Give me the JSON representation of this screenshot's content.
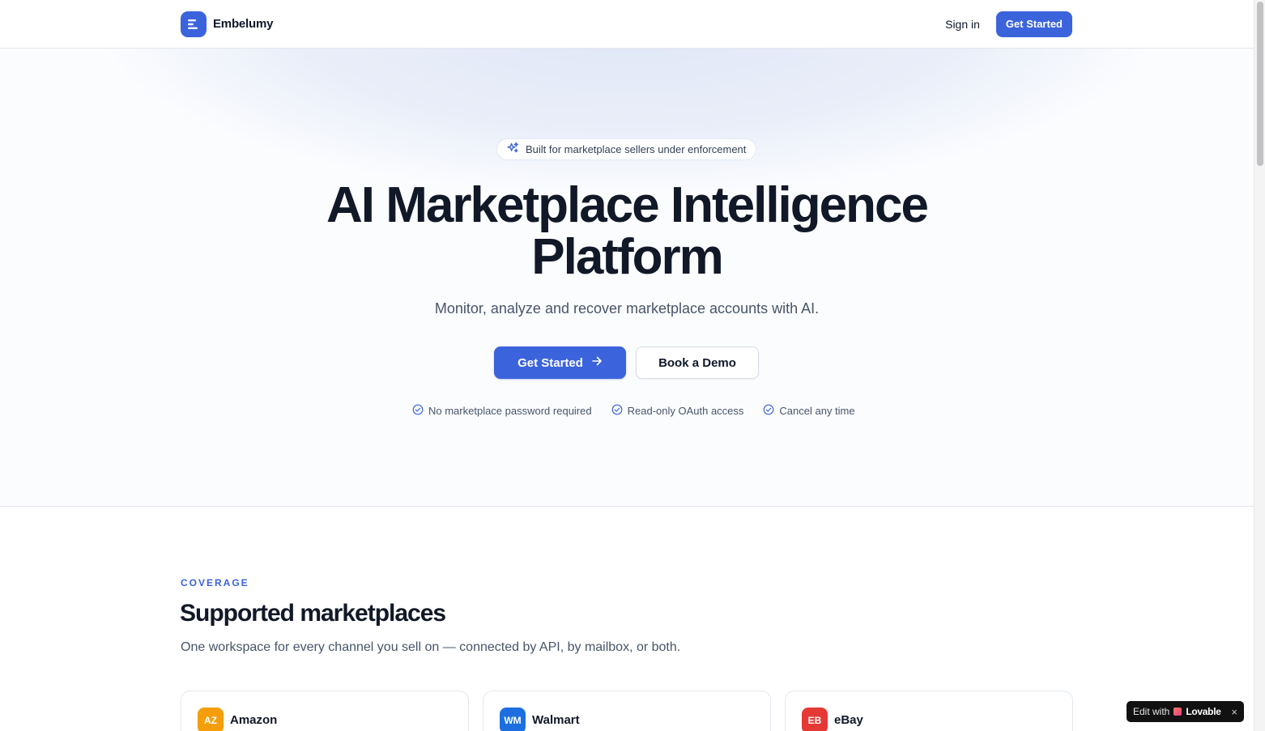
{
  "header": {
    "brand_name": "Embelumy",
    "signin_label": "Sign in",
    "get_started_label": "Get Started"
  },
  "hero": {
    "badge_text": "Built for marketplace sellers under enforcement",
    "title_line1": "AI Marketplace Intelligence",
    "title_line2": "Platform",
    "subtitle": "Monitor, analyze and recover marketplace accounts with AI.",
    "primary_cta": "Get Started",
    "secondary_cta": "Book a Demo",
    "trust": [
      {
        "label": "No marketplace password required"
      },
      {
        "label": "Read-only OAuth access"
      },
      {
        "label": "Cancel any time"
      }
    ]
  },
  "coverage": {
    "eyebrow": "COVERAGE",
    "title": "Supported marketplaces",
    "subtitle": "One workspace for every channel you sell on — connected by API, by mailbox, or both.",
    "marketplaces": [
      {
        "code": "AZ",
        "name": "Amazon",
        "color": "#f59e0b"
      },
      {
        "code": "WM",
        "name": "Walmart",
        "color": "#1d6fe0"
      },
      {
        "code": "EB",
        "name": "eBay",
        "color": "#e53935"
      }
    ]
  },
  "lovable": {
    "edit_label": "Edit with",
    "brand": "Lovable",
    "close_icon": "×"
  },
  "colors": {
    "accent": "#3b63dc",
    "text_primary": "#111827",
    "text_muted": "#475569"
  }
}
